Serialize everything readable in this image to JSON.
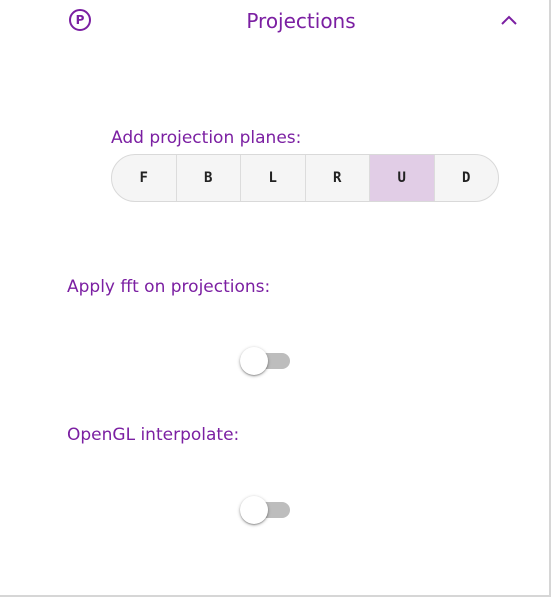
{
  "header": {
    "badge": "P",
    "title": "Projections",
    "collapse_icon": "chevron-up-icon"
  },
  "projection_planes": {
    "label": "Add projection planes:",
    "options": [
      "F",
      "B",
      "L",
      "R",
      "U",
      "D"
    ],
    "selected": "U"
  },
  "fft": {
    "label": "Apply fft on projections:",
    "enabled": false
  },
  "opengl": {
    "label": "OpenGL interpolate:",
    "enabled": false
  },
  "colors": {
    "accent": "#7b1fa2",
    "selected_plane": "#e1cde6",
    "toggle_track_off": "#bdbdbd"
  }
}
